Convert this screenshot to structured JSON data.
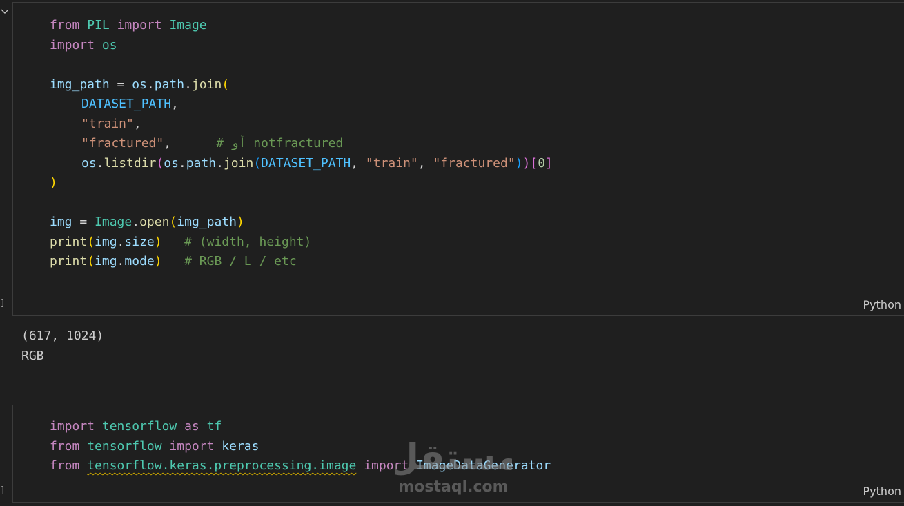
{
  "cells": [
    {
      "language": "Python",
      "code": {
        "l1": {
          "kw1": "from",
          "mod1": "PIL",
          "kw2": "import",
          "mod2": "Image"
        },
        "l2": {
          "kw1": "import",
          "mod1": "os"
        },
        "l4": {
          "var1": "img_path",
          "op1": " = ",
          "var2": "os",
          "op2": ".",
          "var3": "path",
          "op3": ".",
          "fn1": "join",
          "b1": "("
        },
        "l5": {
          "const1": "DATASET_PATH",
          "op1": ","
        },
        "l6": {
          "str1": "\"train\"",
          "op1": ","
        },
        "l7": {
          "str1": "\"fractured\"",
          "op1": ",      ",
          "cmt1": "# أو notfractured"
        },
        "l8": {
          "var1": "os",
          "op1": ".",
          "fn1": "listdir",
          "b1": "(",
          "var2": "os",
          "op2": ".",
          "var3": "path",
          "op3": ".",
          "fn2": "join",
          "b2": "(",
          "const1": "DATASET_PATH",
          "op4": ", ",
          "str1": "\"train\"",
          "op5": ", ",
          "str2": "\"fractured\"",
          "b2c": ")",
          "b1c": ")",
          "b3": "[",
          "num1": "0",
          "b3c": "]"
        },
        "l9": {
          "b1": ")"
        },
        "l11": {
          "var1": "img",
          "op1": " = ",
          "mod1": "Image",
          "op2": ".",
          "fn1": "open",
          "b1": "(",
          "var2": "img_path",
          "b1c": ")"
        },
        "l12": {
          "fn1": "print",
          "b1": "(",
          "var1": "img",
          "op1": ".",
          "var2": "size",
          "b1c": ")",
          "op2": "   ",
          "cmt1": "# (width, height)"
        },
        "l13": {
          "fn1": "print",
          "b1": "(",
          "var1": "img",
          "op1": ".",
          "var2": "mode",
          "b1c": ")",
          "op2": "   ",
          "cmt1": "# RGB / L / etc"
        }
      },
      "exec_bracket": "]",
      "output": [
        "(617, 1024)",
        "RGB"
      ]
    },
    {
      "language": "Python",
      "code": {
        "l1": {
          "kw1": "import",
          "mod1": "tensorflow",
          "kw2": "as",
          "mod2": "tf"
        },
        "l2": {
          "kw1": "from",
          "mod1": "tensorflow",
          "kw2": "import",
          "mod2": "keras"
        },
        "l3": {
          "kw1": "from",
          "mod1": "tensorflow.keras.preprocessing.image",
          "kw2": "import",
          "mod2": "ImageDataGenerator"
        }
      },
      "exec_bracket": "]"
    }
  ],
  "watermark": {
    "brand": "mostaql.com",
    "logo_text": "مستقل"
  },
  "colors": {
    "background": "#1f1f1f",
    "keyword": "#c586c0",
    "module": "#4ec9b0",
    "variable": "#9cdcfe",
    "function": "#dcdcaa",
    "string": "#ce9178",
    "comment": "#6a9955"
  },
  "icons": {
    "collapse": "chevron-down-icon"
  }
}
